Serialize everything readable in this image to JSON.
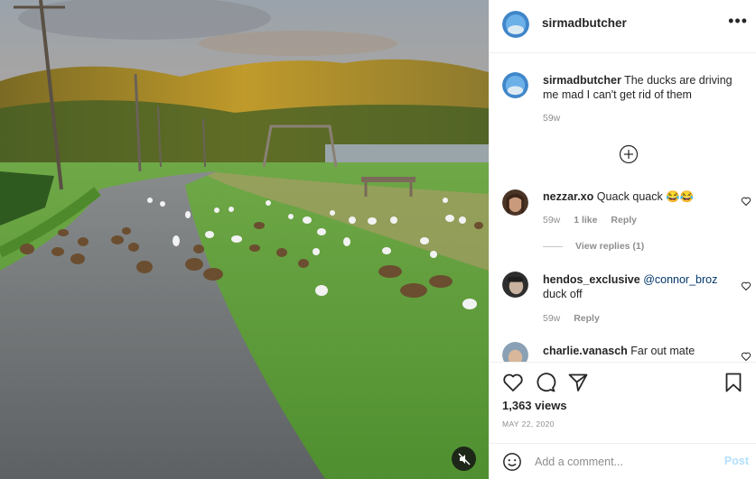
{
  "media": {
    "mute_icon": "speaker-muted-icon"
  },
  "header": {
    "username": "sirmadbutcher",
    "more_icon": "ellipsis-icon",
    "more_glyph": "•••"
  },
  "caption": {
    "username": "sirmadbutcher",
    "text": "The ducks are driving me mad I can't get rid of them",
    "time": "59w"
  },
  "load_more_icon": "plus-circle-icon",
  "comments": [
    {
      "username": "nezzar.xo",
      "text": "Quack quack 😂😂",
      "time": "59w",
      "likes": "1 like",
      "reply_label": "Reply",
      "view_replies": "View replies (1)"
    },
    {
      "username": "hendos_exclusive",
      "mention": "@connor_broz",
      "text": "duck off",
      "time": "59w",
      "reply_label": "Reply"
    },
    {
      "username": "charlie.vanasch",
      "text": "Far out mate"
    }
  ],
  "actions": {
    "like_icon": "heart-icon",
    "comment_icon": "speech-bubble-icon",
    "share_icon": "paper-plane-icon",
    "save_icon": "bookmark-icon",
    "views": "1,363 views",
    "date": "MAY 22, 2020"
  },
  "add_comment": {
    "emoji_icon": "smiley-icon",
    "placeholder": "Add a comment...",
    "post_label": "Post",
    "post_color": "#b2dffc"
  },
  "colors": {
    "grass": "#5c9d3a",
    "road": "#6b6f72",
    "sky": "#b9a999",
    "water": "#9aa5a9"
  }
}
